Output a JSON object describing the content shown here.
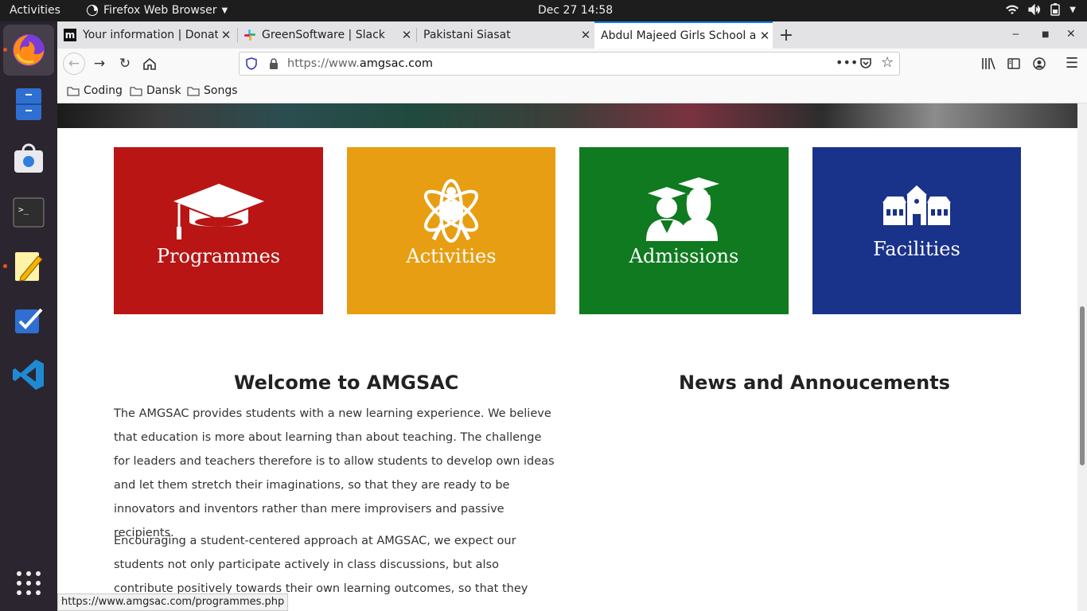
{
  "topbar": {
    "activities": "Activities",
    "app_name": "Firefox Web Browser",
    "clock": "Dec 27  14:58"
  },
  "dock": {
    "items": [
      {
        "name": "firefox",
        "running": true
      },
      {
        "name": "files",
        "running": false
      },
      {
        "name": "software",
        "running": false
      },
      {
        "name": "terminal",
        "running": false
      },
      {
        "name": "text-editor",
        "running": true
      },
      {
        "name": "tasks",
        "running": false
      },
      {
        "name": "vscode",
        "running": false
      }
    ]
  },
  "tabs": [
    {
      "title": "Your information | Donat",
      "favicon": "m"
    },
    {
      "title": "GreenSoftware | Slack",
      "favicon": "slack"
    },
    {
      "title": "Pakistani Siasat",
      "favicon": ""
    },
    {
      "title": "Abdul Majeed Girls School a",
      "favicon": "",
      "active": true
    }
  ],
  "urlbar": {
    "prefix": "https://www.",
    "domain": "amgsac.com"
  },
  "bookmarks": [
    "Coding",
    "Dansk",
    "Songs"
  ],
  "tiles": [
    {
      "label": "Programmes",
      "color": "#b81514"
    },
    {
      "label": "Activities",
      "color": "#e79e13"
    },
    {
      "label": "Admissions",
      "color": "#0f7a1f"
    },
    {
      "label": "Facilities",
      "color": "#19328a"
    }
  ],
  "welcome": {
    "title": "Welcome to AMGSAC",
    "p1": "The AMGSAC provides students with a new learning experience. We believe that education is more about learning than about teaching. The challenge for leaders and teachers therefore is to allow students to develop own ideas and let them stretch their imaginations, so that they are ready to be innovators and inventors rather than mere improvisers and passive recipients.",
    "p2": "Encouraging a student-centered approach at AMGSAC, we expect our students not only participate actively in class discussions, but also contribute positively towards their own learning outcomes, so that they become partners in the"
  },
  "news": {
    "title": "News and Annoucements"
  },
  "status_url": "https://www.amgsac.com/programmes.php"
}
